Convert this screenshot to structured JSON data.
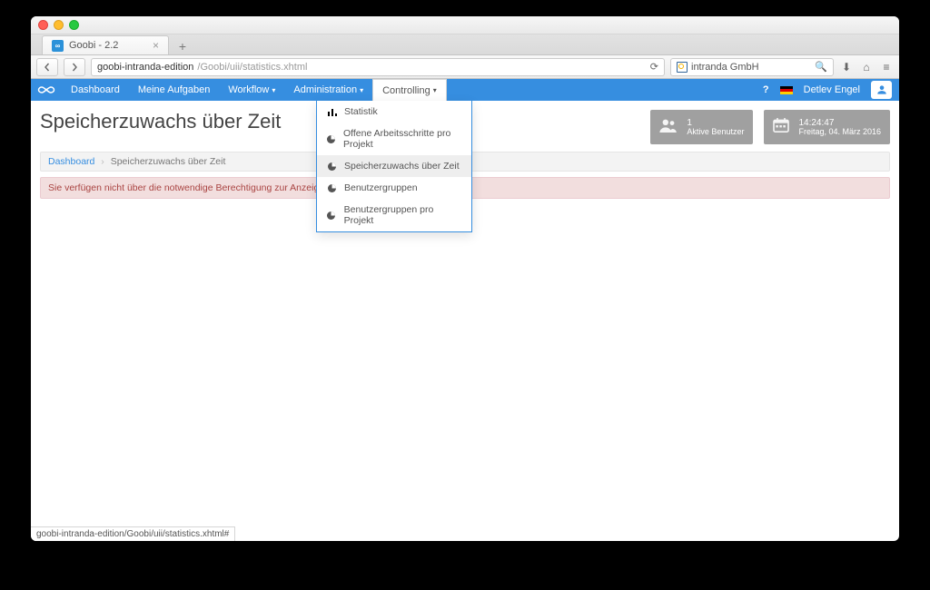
{
  "browser": {
    "tab_title": "Goobi - 2.2",
    "url_host": "goobi-intranda-edition",
    "url_path": "/Goobi/uii/statistics.xhtml",
    "search_value": "intranda GmbH",
    "status_link": "goobi-intranda-edition/Goobi/uii/statistics.xhtml#"
  },
  "nav": {
    "items": [
      {
        "label": "Dashboard",
        "caret": false
      },
      {
        "label": "Meine Aufgaben",
        "caret": false
      },
      {
        "label": "Workflow",
        "caret": true
      },
      {
        "label": "Administration",
        "caret": true
      },
      {
        "label": "Controlling",
        "caret": true,
        "open": true
      }
    ],
    "user_name": "Detlev Engel"
  },
  "dropdown": {
    "items": [
      {
        "label": "Statistik",
        "icon": "bars"
      },
      {
        "label": "Offene Arbeitsschritte pro Projekt",
        "icon": "pie"
      },
      {
        "label": "Speicherzuwachs über Zeit",
        "icon": "pie",
        "active": true
      },
      {
        "label": "Benutzergruppen",
        "icon": "pie"
      },
      {
        "label": "Benutzergruppen pro Projekt",
        "icon": "pie"
      }
    ]
  },
  "page": {
    "title": "Speicherzuwachs über Zeit",
    "breadcrumb": {
      "root": "Dashboard",
      "current": "Speicherzuwachs über Zeit"
    },
    "alert": "Sie verfügen nicht über die notwendige Berechtigung zur Anzeige dieser Statistik."
  },
  "cards": {
    "users": {
      "value": "1",
      "label": "Aktive Benutzer"
    },
    "clock": {
      "value": "14:24:47",
      "label": "Freitag, 04. März 2016"
    }
  }
}
